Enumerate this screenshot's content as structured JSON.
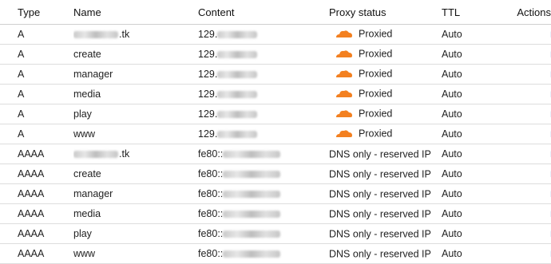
{
  "headers": {
    "type": "Type",
    "name": "Name",
    "content": "Content",
    "proxy": "Proxy status",
    "ttl": "TTL",
    "actions": "Actions"
  },
  "colors": {
    "link": "#1a56c9",
    "cloud": "#f38020"
  },
  "rows": [
    {
      "type": "A",
      "name_visible": ".tk",
      "content_visible": "129.",
      "proxy": "Proxied",
      "proxied": true,
      "ttl": "Auto",
      "action": "Edit"
    },
    {
      "type": "A",
      "name_visible": "create",
      "content_visible": "129.",
      "proxy": "Proxied",
      "proxied": true,
      "ttl": "Auto",
      "action": "Edit"
    },
    {
      "type": "A",
      "name_visible": "manager",
      "content_visible": "129.",
      "proxy": "Proxied",
      "proxied": true,
      "ttl": "Auto",
      "action": "Edit"
    },
    {
      "type": "A",
      "name_visible": "media",
      "content_visible": "129.",
      "proxy": "Proxied",
      "proxied": true,
      "ttl": "Auto",
      "action": "Edit"
    },
    {
      "type": "A",
      "name_visible": "play",
      "content_visible": "129.",
      "proxy": "Proxied",
      "proxied": true,
      "ttl": "Auto",
      "action": "Edit"
    },
    {
      "type": "A",
      "name_visible": "www",
      "content_visible": "129.",
      "proxy": "Proxied",
      "proxied": true,
      "ttl": "Auto",
      "action": "Edit"
    },
    {
      "type": "AAAA",
      "name_visible": ".tk",
      "content_visible": "fe80::",
      "proxy": "DNS only - reserved IP",
      "proxied": false,
      "ttl": "Auto",
      "action": "Edit"
    },
    {
      "type": "AAAA",
      "name_visible": "create",
      "content_visible": "fe80::",
      "proxy": "DNS only - reserved IP",
      "proxied": false,
      "ttl": "Auto",
      "action": "Edit"
    },
    {
      "type": "AAAA",
      "name_visible": "manager",
      "content_visible": "fe80::",
      "proxy": "DNS only - reserved IP",
      "proxied": false,
      "ttl": "Auto",
      "action": "Edit"
    },
    {
      "type": "AAAA",
      "name_visible": "media",
      "content_visible": "fe80::",
      "proxy": "DNS only - reserved IP",
      "proxied": false,
      "ttl": "Auto",
      "action": "Edit"
    },
    {
      "type": "AAAA",
      "name_visible": "play",
      "content_visible": "fe80::",
      "proxy": "DNS only - reserved IP",
      "proxied": false,
      "ttl": "Auto",
      "action": "Edit"
    },
    {
      "type": "AAAA",
      "name_visible": "www",
      "content_visible": "fe80::",
      "proxy": "DNS only - reserved IP",
      "proxied": false,
      "ttl": "Auto",
      "action": "Edit"
    }
  ]
}
